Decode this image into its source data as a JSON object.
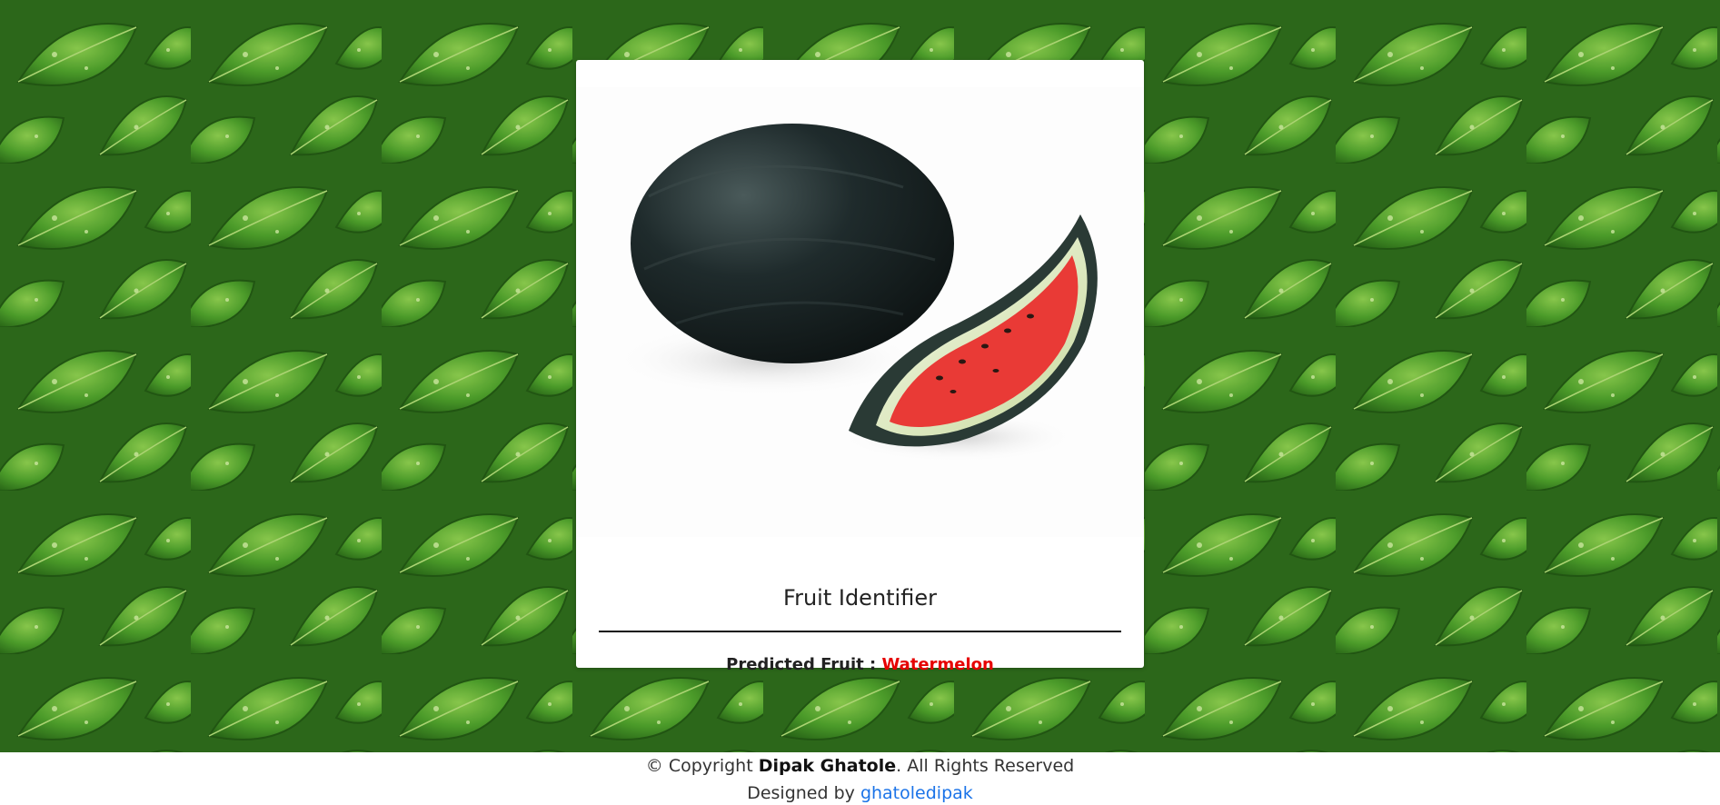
{
  "colors": {
    "background_leaf": "#3f8a26",
    "card": "#ffffff",
    "predicted_fruit": "#e60000",
    "link": "#1a73e8"
  },
  "card": {
    "image_alt": "watermelon-image",
    "title": "Fruit Identifier",
    "prediction_label": "Predicted Fruit : ",
    "prediction_value": "Watermelon"
  },
  "footer": {
    "copyright_prefix": "© Copyright ",
    "owner": "Dipak Ghatole",
    "copyright_suffix": ". All Rights Reserved",
    "designed_prefix": "Designed by ",
    "designer_link": "ghatoledipak"
  }
}
